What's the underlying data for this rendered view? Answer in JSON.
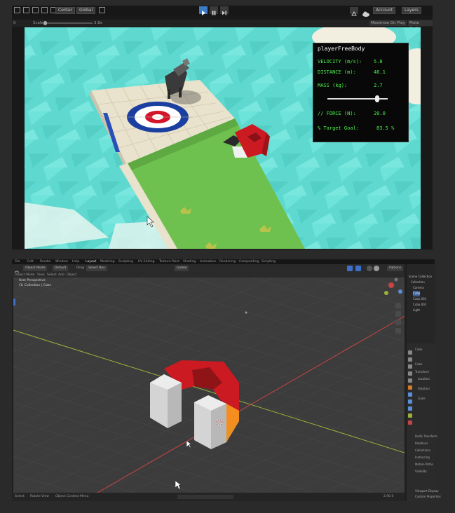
{
  "unity": {
    "toolbar": {
      "center_label": "Center",
      "global_label": "Global",
      "account_label": "Account",
      "layers_label": "Layers"
    },
    "game_toolbar": {
      "display_label": "0",
      "scale_label": "Scale",
      "scale_value": "3.8x",
      "maximize_label": "Maximize On Play",
      "mute_label": "Mute Audio"
    },
    "hud": {
      "title": "playerFreeBody",
      "velocity_label": "VELOCITY (m/s):",
      "velocity_value": "5.8",
      "distance_label": "DISTANCE (m):",
      "distance_value": "46.1",
      "mass_label": "MASS (kg):",
      "mass_value": "2.7",
      "mass_slider_fraction": 0.82,
      "force_label": "// FORCE (N):",
      "force_value": "20.0",
      "target_label": "% Target Goal:",
      "target_value": "83.5 %"
    },
    "colors": {
      "water": "#5fd9d0",
      "grass": "#6fc14f",
      "target_blue": "#1b3fa0",
      "target_red": "#d4142a",
      "hud_text": "#4cf04c"
    }
  },
  "blender": {
    "menu": [
      "File",
      "Edit",
      "Render",
      "Window",
      "Help",
      "Layout",
      "Modeling",
      "Sculpting",
      "UV Editing",
      "Texture Paint",
      "Shading",
      "Animation",
      "Rendering",
      "Compositing",
      "Scripting"
    ],
    "header": {
      "mode_label": "Object Mode",
      "orientation_label": "Default",
      "drag_label": "Drag",
      "select_label": "Select Box",
      "global_label": "Global",
      "options_label": "Options"
    },
    "sub_menu": [
      "View",
      "Select",
      "Add",
      "Object"
    ],
    "viewport": {
      "view_label": "User Perspective",
      "collection_label": "(1) Collection | Cube"
    },
    "outliner": {
      "rows": [
        "Scene Collection",
        "Collection",
        "Camera",
        "Cube",
        "Cube.001",
        "Cube.002",
        "Light"
      ]
    },
    "properties": {
      "object_name": "Cube",
      "rows": [
        "Cube",
        "Transform",
        "Location",
        "Rotation",
        "Scale",
        "Delta Transform",
        "Relations",
        "Collections",
        "Instancing",
        "Motion Paths",
        "Visibility",
        "Viewport Display",
        "Custom Properties"
      ]
    },
    "status": {
      "select_label": "Select",
      "rotate_label": "Rotate View",
      "menu_label": "Object Context Menu",
      "version": "2.90.0"
    },
    "colors": {
      "magnet_red": "#cc1a22",
      "magnet_grey": "#d4d4d4",
      "grid_bg": "#3c3c3c",
      "axis_x": "#c84444",
      "axis_y": "#9ab23a"
    }
  }
}
